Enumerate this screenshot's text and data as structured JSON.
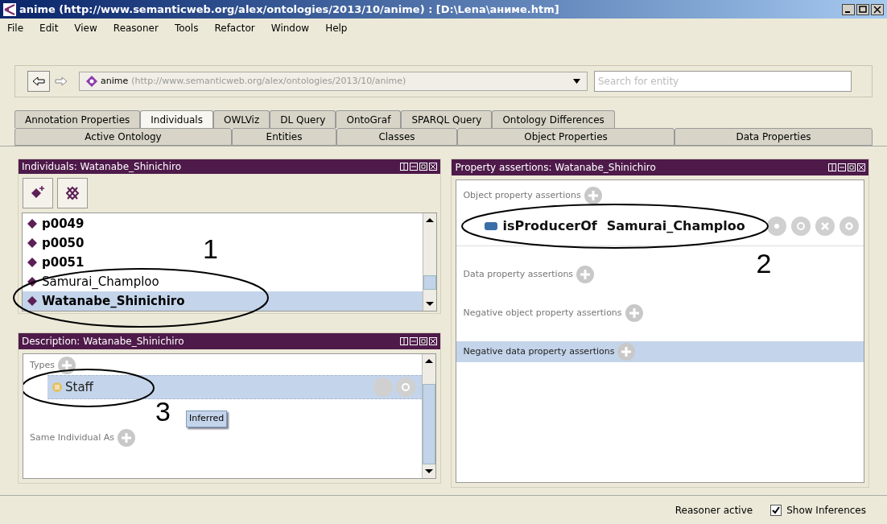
{
  "window": {
    "title": "anime (http://www.semanticweb.org/alex/ontologies/2013/10/anime) : [D:\\Lena\\аниме.htm]"
  },
  "menu": [
    "File",
    "Edit",
    "View",
    "Reasoner",
    "Tools",
    "Refactor",
    "Window",
    "Help"
  ],
  "toolbar": {
    "ontology_name": "anime",
    "ontology_iri": "(http://www.semanticweb.org/alex/ontologies/2013/10/anime)",
    "search": {
      "placeholder": "Search for entity"
    }
  },
  "tabs_row_1": [
    {
      "label": "Annotation Properties",
      "selected": false
    },
    {
      "label": "Individuals",
      "selected": true
    },
    {
      "label": "OWLViz",
      "selected": false
    },
    {
      "label": "DL Query",
      "selected": false
    },
    {
      "label": "OntoGraf",
      "selected": false
    },
    {
      "label": "SPARQL Query",
      "selected": false
    },
    {
      "label": "Ontology Differences",
      "selected": false
    }
  ],
  "tabs_row_2": [
    {
      "label": "Active Ontology",
      "selected": false
    },
    {
      "label": "Entities",
      "selected": false
    },
    {
      "label": "Classes",
      "selected": false
    },
    {
      "label": "Object Properties",
      "selected": false
    },
    {
      "label": "Data Properties",
      "selected": false
    }
  ],
  "individuals_panel": {
    "title": "Individuals: Watanabe_Shinichiro",
    "items": [
      {
        "label": "p0049",
        "bold": true,
        "selected": false
      },
      {
        "label": "p0050",
        "bold": true,
        "selected": false
      },
      {
        "label": "p0051",
        "bold": true,
        "selected": false
      },
      {
        "label": "Samurai_Champloo",
        "bold": false,
        "selected": false
      },
      {
        "label": "Watanabe_Shinichiro",
        "bold": true,
        "selected": true
      }
    ]
  },
  "description_panel": {
    "title": "Description: Watanabe_Shinichiro",
    "sections": [
      {
        "label": "Types",
        "entries": [
          {
            "label": "Staff",
            "selected": true
          }
        ]
      },
      {
        "label": "Same Individual As"
      }
    ],
    "tooltip": "Inferred"
  },
  "property_panel": {
    "title": "Property assertions: Watanabe_Shinichiro",
    "sections": [
      {
        "label": "Object property assertions",
        "selected": false,
        "entries": [
          {
            "property": "isProducerOf",
            "value": "Samurai_Champloo"
          }
        ]
      },
      {
        "label": "Data property assertions",
        "selected": false
      },
      {
        "label": "Negative object property assertions",
        "selected": false
      },
      {
        "label": "Negative data property assertions",
        "selected": true
      }
    ]
  },
  "status_bar": {
    "reasoner": "Reasoner active",
    "show_inferences": {
      "label": "Show Inferences",
      "checked": true
    }
  },
  "annotations": [
    {
      "label": "1"
    },
    {
      "label": "2"
    },
    {
      "label": "3"
    }
  ]
}
